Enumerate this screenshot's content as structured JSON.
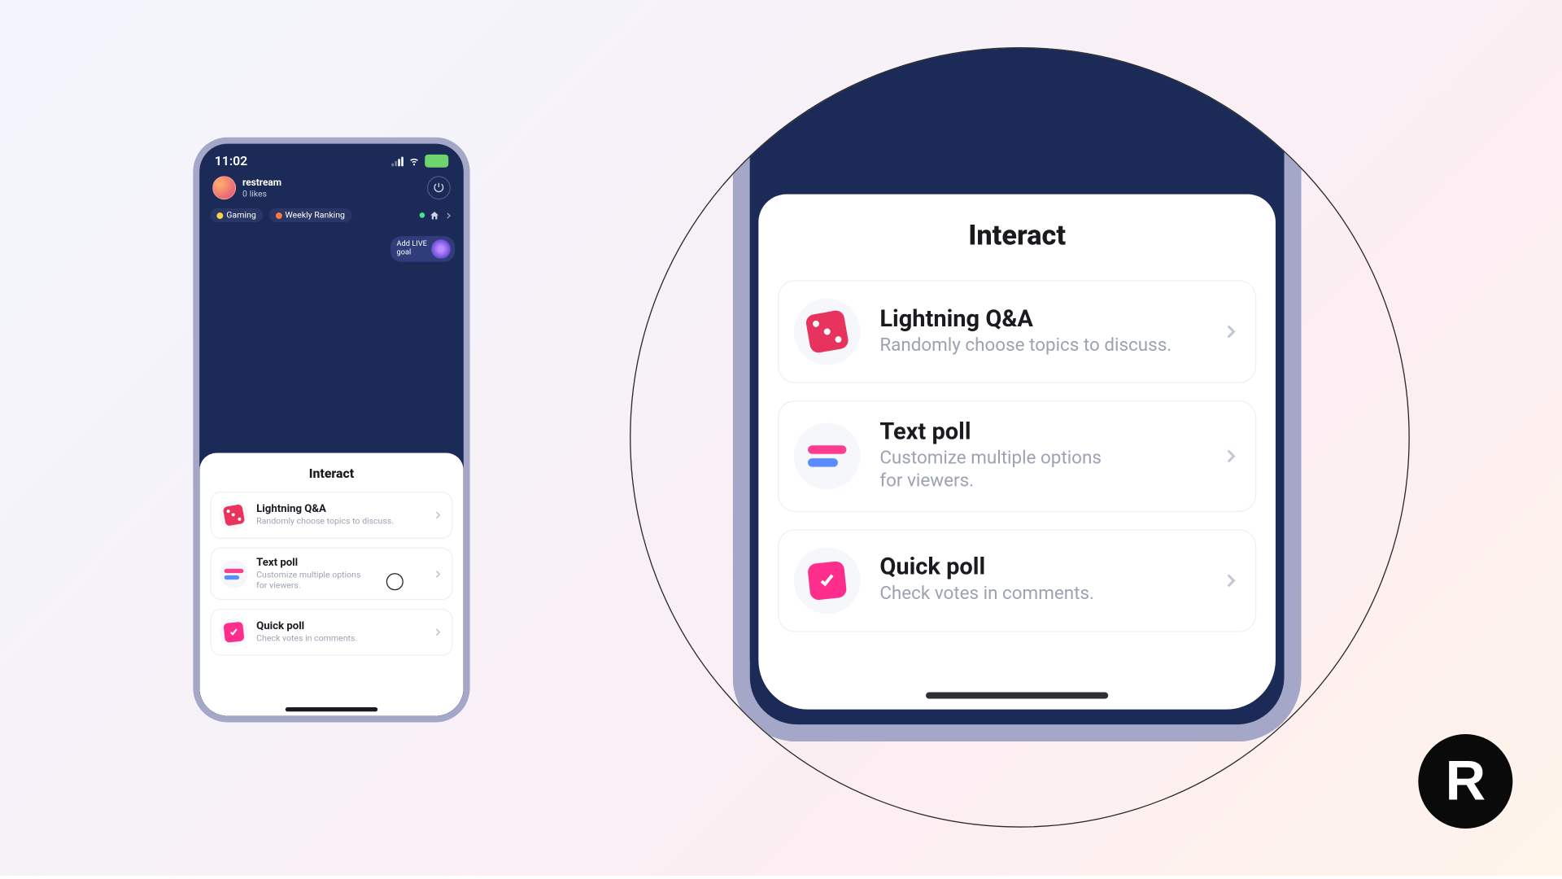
{
  "statusbar": {
    "time": "11:02",
    "battery_label": ""
  },
  "profile": {
    "name": "restream",
    "likes": "0 likes"
  },
  "chips": {
    "gaming": "Gaming",
    "ranking": "Weekly Ranking"
  },
  "goal": {
    "line1": "Add LIVE",
    "line2": "goal"
  },
  "panel": {
    "title": "Interact",
    "options": [
      {
        "title": "Lightning Q&A",
        "desc_small": "Randomly choose topics to discuss.",
        "desc_big": "Randomly choose topics to discuss."
      },
      {
        "title": "Text poll",
        "desc_small": "Customize multiple options\nfor viewers.",
        "desc_big": "Customize multiple options\nfor viewers."
      },
      {
        "title": "Quick poll",
        "desc_small": "Check votes in comments.",
        "desc_big": "Check votes in comments."
      }
    ]
  },
  "logo": "R"
}
